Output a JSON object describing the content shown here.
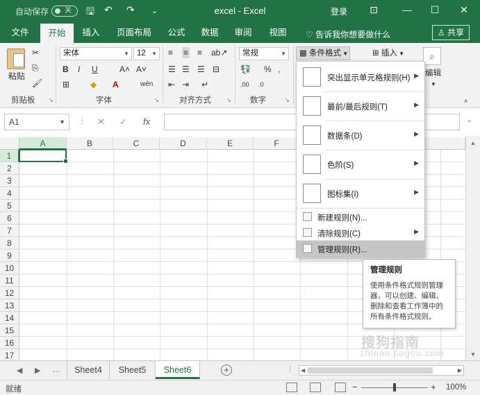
{
  "titlebar": {
    "autosave_label": "自动保存",
    "autosave_state": "关",
    "title": "excel - Excel",
    "login": "登录",
    "min": "—",
    "max": "☐",
    "close": "✕"
  },
  "menu": {
    "tabs": [
      "文件",
      "开始",
      "插入",
      "页面布局",
      "公式",
      "数据",
      "审阅",
      "视图"
    ],
    "active_tab": "开始",
    "tell_me": "告诉我你想要做什么",
    "share": "共享"
  },
  "ribbon": {
    "groups": [
      "剪贴板",
      "字体",
      "对齐方式",
      "数字",
      "编辑"
    ],
    "paste": "粘贴",
    "font_name": "宋体",
    "font_size": "12",
    "number_format": "常规",
    "conditional_format": "条件格式",
    "insert": "插入",
    "edit": "编辑"
  },
  "formula_bar": {
    "name_box": "A1",
    "fx": "fx"
  },
  "grid": {
    "columns": [
      "A",
      "B",
      "C",
      "D",
      "E",
      "F"
    ],
    "rows": [
      "1",
      "2",
      "3",
      "4",
      "5",
      "6",
      "7",
      "8",
      "9",
      "10",
      "11",
      "12",
      "13",
      "14",
      "15",
      "16",
      "17"
    ],
    "active_cell": "A1"
  },
  "dropdown": {
    "items": [
      {
        "label": "突出显示单元格规则(H)",
        "icon": "highlight-rules-icon"
      },
      {
        "label": "最前/最后规则(T)",
        "icon": "top-bottom-rules-icon"
      },
      {
        "label": "数据条(D)",
        "icon": "data-bars-icon"
      },
      {
        "label": "色阶(S)",
        "icon": "color-scales-icon"
      },
      {
        "label": "图标集(I)",
        "icon": "icon-sets-icon"
      }
    ],
    "small_items": [
      {
        "label": "新建规则(N)...",
        "icon": "new-rule-icon"
      },
      {
        "label": "清除规则(C)",
        "icon": "clear-rules-icon"
      },
      {
        "label": "管理规则(R)...",
        "icon": "manage-rules-icon"
      }
    ]
  },
  "tooltip": {
    "title": "管理规则",
    "body": "使用条件格式规则管理器，可以创建、编辑、删除和查看工作簿中的所有条件格式规则。"
  },
  "sheets": {
    "ellipsis": "...",
    "tabs": [
      "Sheet4",
      "Sheet5",
      "Sheet6"
    ],
    "active": "Sheet6"
  },
  "status": {
    "ready": "就绪",
    "zoom": "100%"
  },
  "watermark": {
    "text": "搜狗指南",
    "sub": "zhinan.sogou.com"
  },
  "colors": {
    "accent": "#217346",
    "ribbon_bg": "#f3f3f3"
  }
}
